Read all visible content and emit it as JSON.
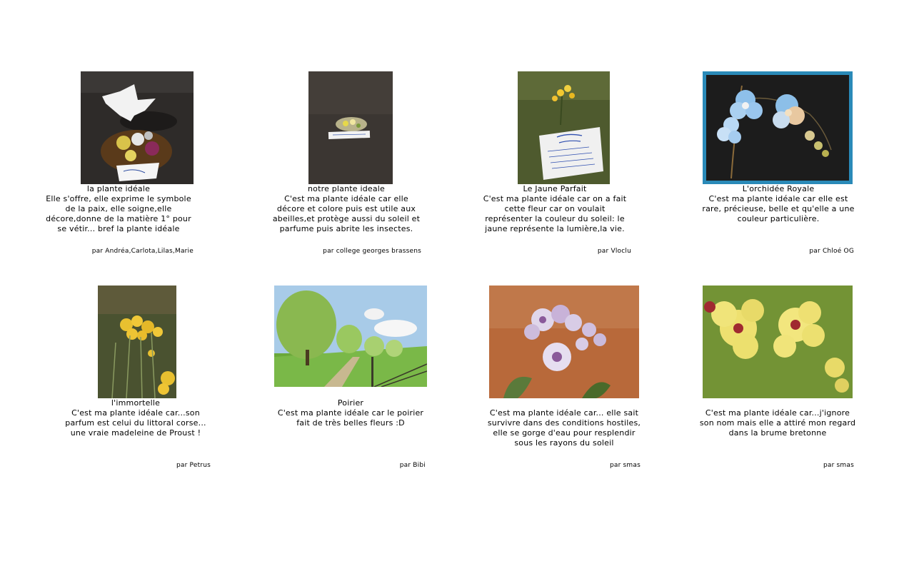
{
  "cards": [
    {
      "title": "la plante idéale",
      "desc": "Elle s'offre, elle exprime le symbole de la paix, elle soigne,elle décore,donne de la matière 1° pour se vétir... bref la plante idéale",
      "author": "par Andréa,Carlota,Lilas,Marie",
      "image_alt": "dove-and-flower-arrangement-photo"
    },
    {
      "title": "notre plante ideale",
      "desc": "C'est ma plante idéale car elle décore et colore puis est utile aux abeilles,et protège aussi du soleil et parfume puis abrite les insectes.",
      "author": "par college georges brassens",
      "image_alt": "small-flower-on-asphalt-photo"
    },
    {
      "title": "Le Jaune Parfait",
      "desc": "C'est ma plante idéale car on a fait cette fleur car on voulait représenter la couleur du soleil: le jaune représente la lumière,la vie.",
      "author": "par Vloclu",
      "image_alt": "yellow-flower-with-note-photo"
    },
    {
      "title": "L'orchidée Royale",
      "desc": "C'est ma plante idéale car elle est rare, précieuse, belle et qu'elle a une couleur particulière.",
      "author": "par Chloé OG",
      "image_alt": "blue-orchid-photo"
    },
    {
      "title": "l'immortelle",
      "desc": "C'est ma plante idéale car...son parfum est celui du littoral corse... une vraie madeleine de Proust !",
      "author": "par Petrus",
      "image_alt": "yellow-immortelle-photo"
    },
    {
      "title": "Poirier",
      "desc": "C'est ma plante idéale car le poirier fait de très belles fleurs :D",
      "author": "par Bibi",
      "image_alt": "pear-tree-orchard-photo"
    },
    {
      "title": "",
      "desc": "C'est ma plante idéale car... elle sait survivre dans des conditions hostiles, elle se gorge d'eau pour resplendir sous les rayons du soleil",
      "author": "par smas",
      "image_alt": "calotropis-flower-photo"
    },
    {
      "title": "",
      "desc": "C'est ma plante idéale car...j'ignore son nom mais elle a attiré mon regard dans la brume bretonne",
      "author": "par smas",
      "image_alt": "yellow-mullein-flower-photo"
    }
  ]
}
